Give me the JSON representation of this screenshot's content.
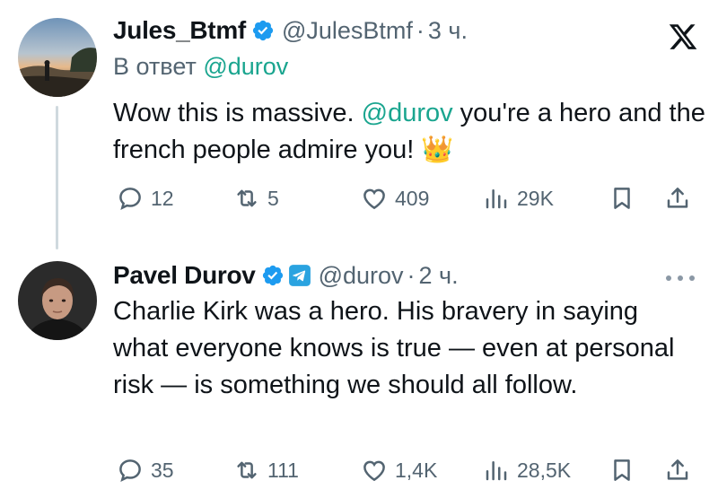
{
  "tweets": [
    {
      "author_name": "Jules_Btmf",
      "handle": "@JulesBtmf",
      "separator": "·",
      "time": "3 ч.",
      "reply_prefix": "В ответ",
      "reply_mention": "@durov",
      "text_before": "Wow this is massive. ",
      "text_mention": "@durov",
      "text_after": "  you're a hero and the french people admire you! ",
      "emoji": "👑",
      "counts": {
        "replies": "12",
        "reposts": "5",
        "likes": "409",
        "views": "29K"
      }
    },
    {
      "author_name": "Pavel Durov",
      "handle": "@durov",
      "separator": "·",
      "time": "2 ч.",
      "text": "Charlie Kirk was a hero. His bravery in saying what everyone knows is true — even at personal risk — is something we should all follow.",
      "counts": {
        "replies": "35",
        "reposts": "111",
        "likes": "1,4K",
        "views": "28,5K"
      }
    }
  ],
  "icons": {
    "platform_logo": "x-logo-icon",
    "verified": "verified-badge-icon",
    "telegram": "telegram-badge-icon",
    "more": "more-options-icon",
    "reply": "comment-icon",
    "repost": "repost-icon",
    "like": "heart-icon",
    "views": "views-chart-icon",
    "bookmark": "bookmark-icon",
    "share": "share-icon"
  },
  "colors": {
    "verified_blue": "#1d9bf0",
    "mention_teal": "#1aa58f",
    "secondary_text": "#536471",
    "thread_line": "#cfd9de"
  }
}
